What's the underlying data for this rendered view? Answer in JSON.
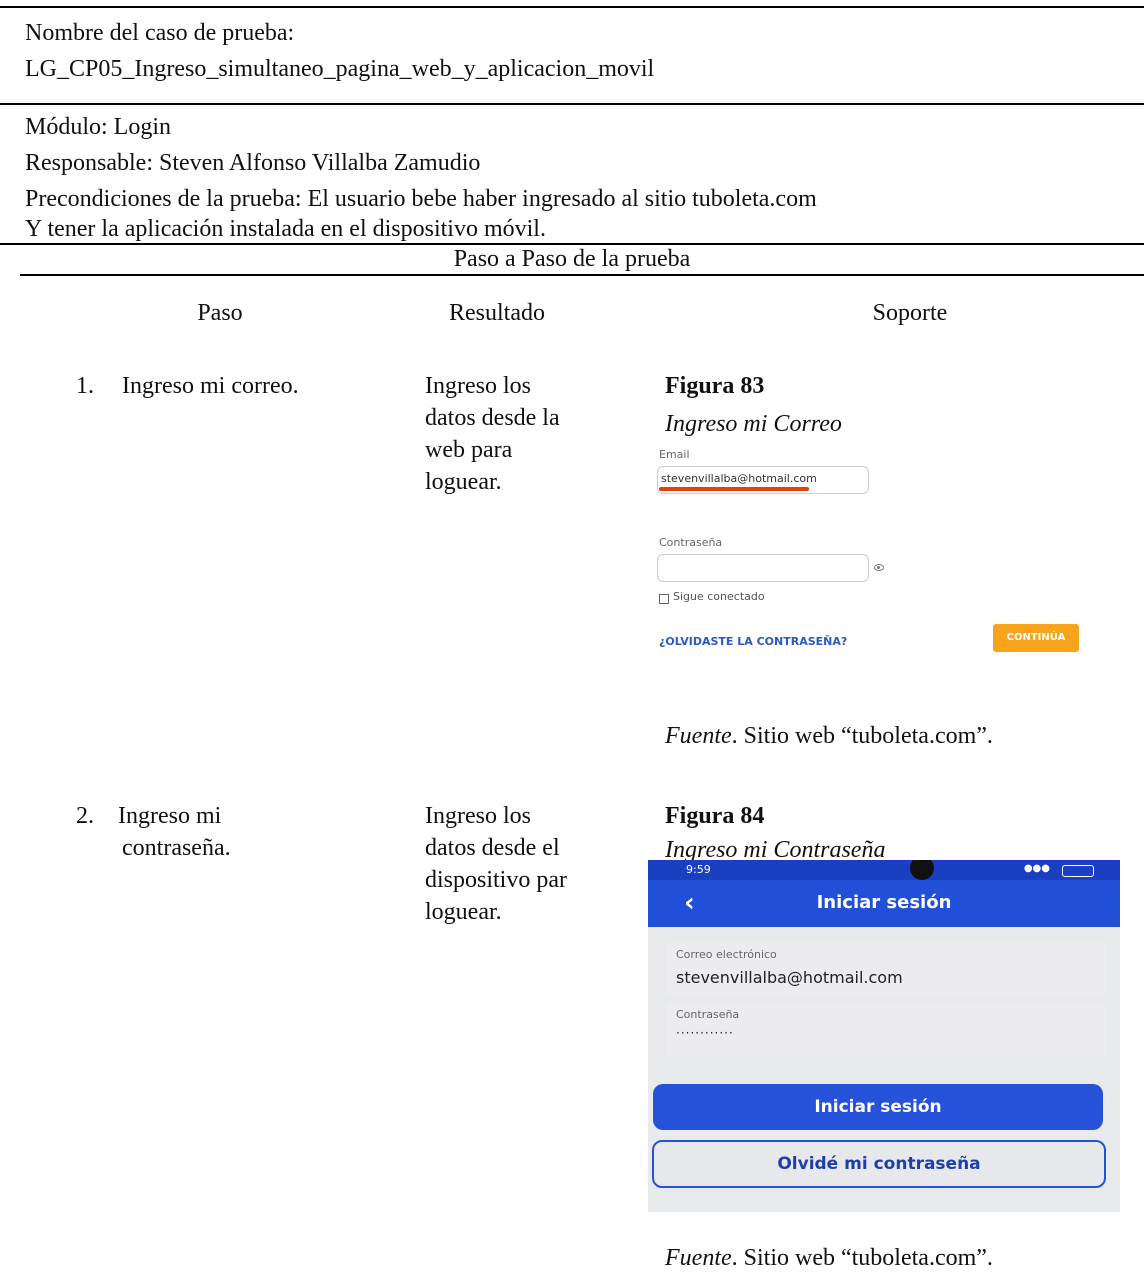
{
  "header": {
    "test_case_label": "Nombre del caso de prueba:",
    "test_case_name": "LG_CP05_Ingreso_simultaneo_pagina_web_y_aplicacion_movil",
    "module": "Módulo: Login",
    "responsible": "Responsable:  Steven Alfonso Villalba Zamudio",
    "preconditions_1": "Precondiciones de la prueba: El usuario bebe haber ingresado al sitio tuboleta.com",
    "preconditions_2": "Y tener la aplicación instalada en el dispositivo móvil."
  },
  "steps_table": {
    "section_title": "Paso a Paso de la prueba",
    "columns": [
      "Paso",
      "Resultado",
      "Soporte"
    ],
    "rows": [
      {
        "step_number": "1.",
        "step_text_1": "Ingreso mi correo.",
        "step_text_2": "",
        "result_lines": [
          "Ingreso los",
          "datos desde la",
          "web para",
          "loguear."
        ],
        "figure_title": "Figura 83",
        "figure_subtitle": "Ingreso mi Correo",
        "source_label": "Fuente",
        "source_text": ". Sitio web “tuboleta.com”."
      },
      {
        "step_number": "2.",
        "step_text_1": "Ingreso mi",
        "step_text_2": "contraseña.",
        "result_lines": [
          "Ingreso los",
          "datos desde el",
          "dispositivo par",
          "loguear."
        ],
        "figure_title": "Figura 84",
        "figure_subtitle": "Ingreso mi Contraseña",
        "source_label": "Fuente",
        "source_text": ". Sitio web “tuboleta.com”."
      }
    ]
  },
  "web_form": {
    "email_label": "Email",
    "email_value": "stevenvillalba@hotmail.com",
    "password_label": "Contraseña",
    "password_value": "",
    "remember_label": "Sigue conectado",
    "forgot_link": "¿OLVIDASTE LA CONTRASEÑA?",
    "continue_button": "CONTINÚA",
    "accent_color": "#f6a41b",
    "underline_color": "#e0440e"
  },
  "mobile_app": {
    "status_time": "9:59",
    "title": "Iniciar sesión",
    "email_label": "Correo electrónico",
    "email_value": "stevenvillalba@hotmail.com",
    "password_label": "Contraseña",
    "password_value": "············",
    "login_button": "Iniciar sesión",
    "forgot_button": "Olvidé mi contraseña",
    "brand_color": "#2552d8"
  }
}
